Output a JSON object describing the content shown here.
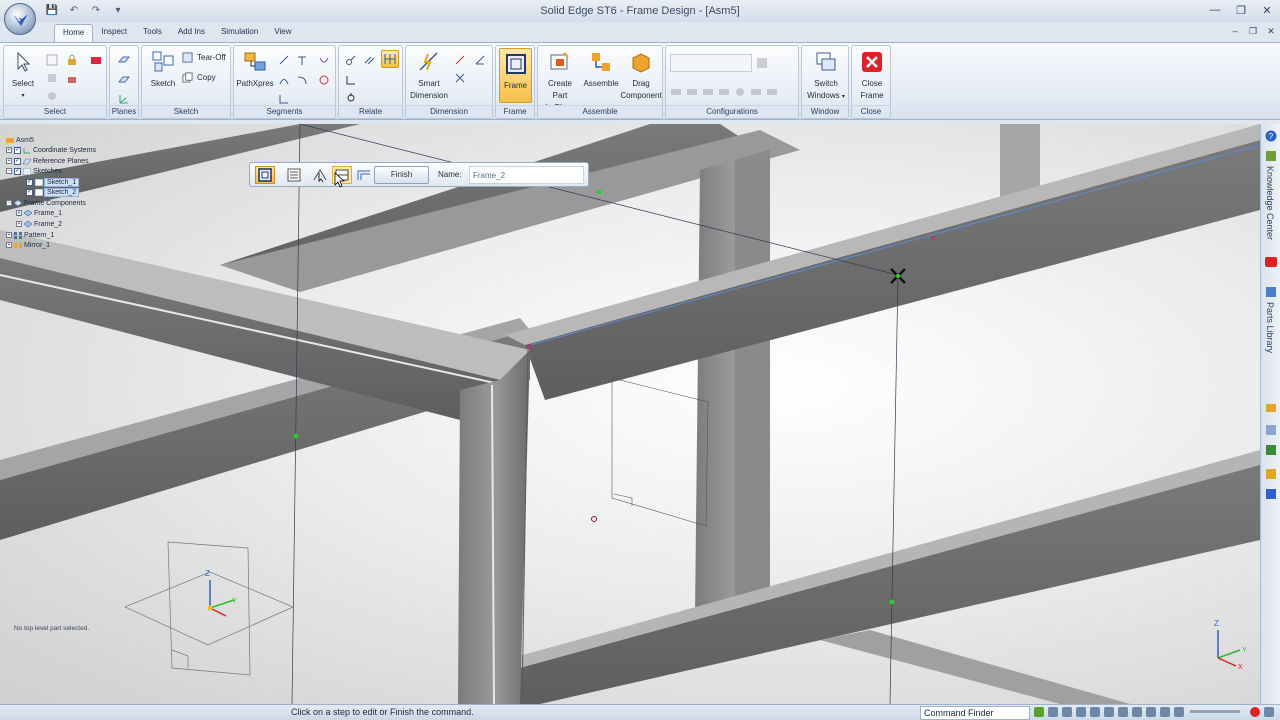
{
  "window": {
    "title": "Solid Edge ST6 - Frame Design - [Asm5]"
  },
  "tabs": [
    {
      "label": "Home"
    },
    {
      "label": "Inspect"
    },
    {
      "label": "Tools"
    },
    {
      "label": "Add Ins"
    },
    {
      "label": "Simulation"
    },
    {
      "label": "View"
    }
  ],
  "ribbon": {
    "groups": {
      "select": "Select",
      "planes": "Planes",
      "sketch": "Sketch",
      "segments": "Segments",
      "relate": "Relate",
      "dimension": "Dimension",
      "frame": "Frame",
      "assemble": "Assemble",
      "configurations": "Configurations",
      "window": "Window",
      "close": "Close"
    },
    "buttons": {
      "select": "Select",
      "tear_off": "Tear-Off",
      "copy": "Copy",
      "sketch": "Sketch",
      "pathxpres": "PathXpres",
      "smart_dimension_1": "Smart",
      "smart_dimension_2": "Dimension",
      "frame": "Frame",
      "create_part_1": "Create Part",
      "create_part_2": "In-Place",
      "assemble": "Assemble",
      "drag_component_1": "Drag",
      "drag_component_2": "Component",
      "switch_windows_1": "Switch",
      "switch_windows_2": "Windows",
      "close_frame_1": "Close",
      "close_frame_2": "Frame"
    }
  },
  "pathfinder": {
    "items": [
      {
        "label": "Asm5"
      },
      {
        "label": "Coordinate Systems"
      },
      {
        "label": "Reference Planes"
      },
      {
        "label": "Sketches"
      },
      {
        "label": "Sketch_1"
      },
      {
        "label": "Sketch_2"
      },
      {
        "label": "Frame Components"
      },
      {
        "label": "Frame_1"
      },
      {
        "label": "Frame_2"
      },
      {
        "label": "Pattern_1"
      },
      {
        "label": "Mirror_1"
      }
    ],
    "status": "No top level part selected."
  },
  "commandbar": {
    "finish_label": "Finish",
    "name_label": "Name:",
    "name_value": "Frame_2"
  },
  "rightdock": {
    "knowledge_center": "Knowledge Center",
    "parts_library": "Parts Library"
  },
  "statusbar": {
    "prompt": "Click on a step to edit or Finish the command.",
    "command_finder": "Command Finder"
  },
  "colors": {
    "accent": "#f8c04a",
    "ribbon": "#e4ebf4",
    "close_red": "#d9242a",
    "highlight_green": "#2ecc2e",
    "frame_steel": "#8a8a8a"
  }
}
